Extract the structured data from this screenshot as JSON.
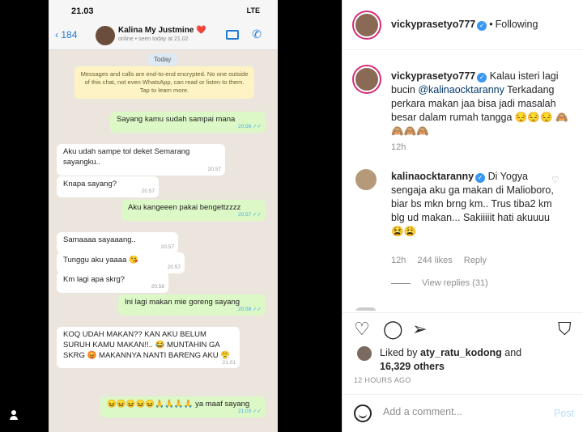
{
  "phone": {
    "time": "21.03",
    "signal": "LTE",
    "back_count": "184",
    "contact_name": "Kalina My Justmine ❤️",
    "contact_sub": "online • seen today at 21.02",
    "day_label": "Today",
    "encryption_notice": "Messages and calls are end-to-end encrypted. No one outside of this chat, not even WhatsApp, can read or listen to them. Tap to learn more.",
    "messages": [
      {
        "dir": "out",
        "text": "Sayang kamu sudah sampai mana",
        "time": "20.56"
      },
      {
        "dir": "in",
        "text": "Aku udah sampe tol deket Semarang sayangku..",
        "time": "20.57"
      },
      {
        "dir": "in",
        "text": "Knapa sayang?",
        "time": "20.57"
      },
      {
        "dir": "out",
        "text": "Aku kangeeen pakai bengettzzzz",
        "time": "20.57"
      },
      {
        "dir": "in",
        "text": "Samaaaa sayaaang..",
        "time": "20.57"
      },
      {
        "dir": "in",
        "text": "Tunggu aku yaaaa 😘",
        "time": "20.57"
      },
      {
        "dir": "in",
        "text": "Km lagi apa skrg?",
        "time": "20.58"
      },
      {
        "dir": "out",
        "text": "Ini lagi makan mie goreng sayang",
        "time": "20.58"
      },
      {
        "dir": "in",
        "text": "KOQ UDAH MAKAN?? KAN AKU BELUM SURUH KAMU MAKAN!!.. 😂 MUNTAHIN GA SKRG 😡 MAKANNYA NANTI BARENG AKU 😤",
        "time": "21.01"
      },
      {
        "dir": "out",
        "text": "😖😖😖😖😖🙏🙏🙏🙏 ya maaf sayang",
        "time": "21.03"
      }
    ]
  },
  "post": {
    "author": "vickyprasetyo777",
    "follow_label": "Following",
    "caption_user": "vickyprasetyo777",
    "caption_pre": "Kalau isteri lagi bucin ",
    "caption_mention": "@kalinaocktaranny",
    "caption_post": " Terkadang perkara makan jaa bisa jadi masalah besar dalam rumah tangga 😔😔😔 🙈🙈🙈🙈",
    "caption_age": "12h",
    "comment": {
      "user": "kalinaocktaranny",
      "text": "Di Yogya sengaja aku ga makan di Malioboro, biar bs mkn brng km.. Trus tiba2 km blg ud makan... Sakiiiiit hati akuuuu 😫😩",
      "age": "12h",
      "likes": "244 likes",
      "reply": "Reply",
      "view_replies": "View replies (31)"
    },
    "liked_by_label": "Liked by",
    "liked_by_user": "aty_ratu_kodong",
    "liked_and": "and",
    "liked_others": "16,329 others",
    "time_ago": "12 HOURS AGO",
    "comment_placeholder": "Add a comment...",
    "post_button": "Post"
  },
  "colors": {
    "accent": "#3897f0",
    "bubble_out": "#dcf8c6",
    "bubble_in": "#ffffff",
    "chat_bg": "#ece5dd"
  }
}
